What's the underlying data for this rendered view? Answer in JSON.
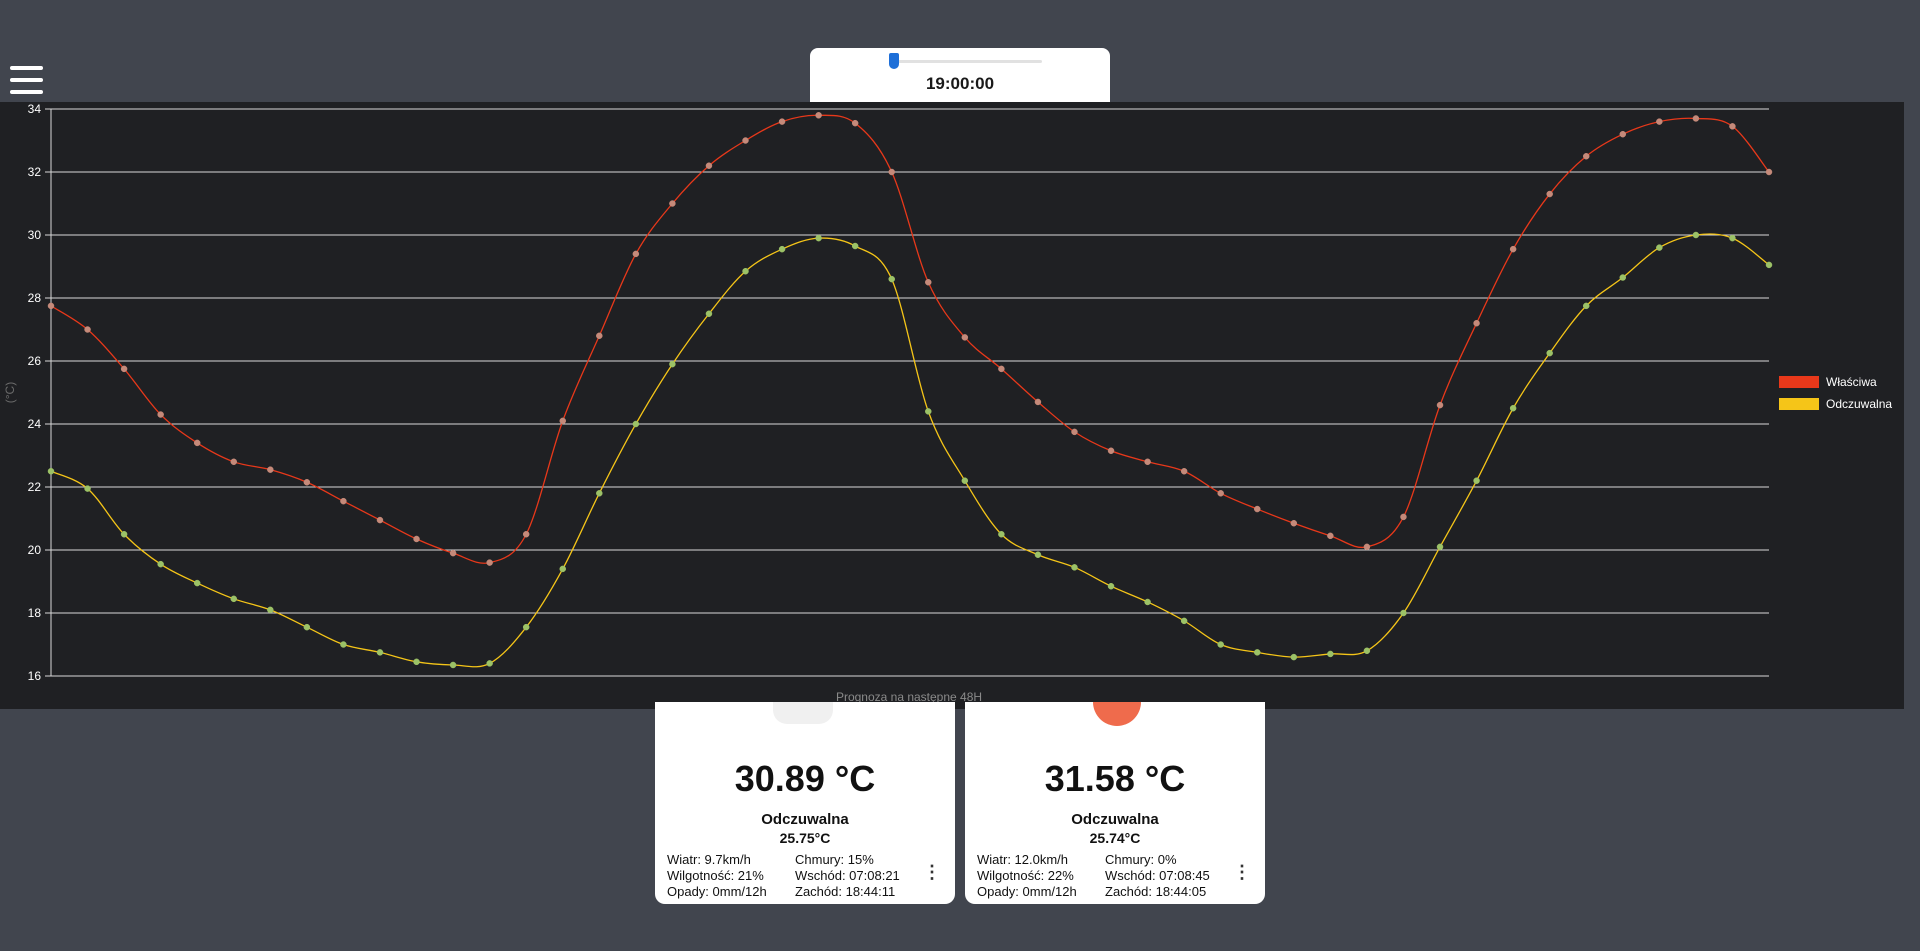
{
  "menu": {
    "icon": "hamburger-menu-icon"
  },
  "time_slider": {
    "time": "19:00:00",
    "position": 0.0
  },
  "chart_data": {
    "type": "line",
    "title": "",
    "xlabel": "Prognoza na następne 48H",
    "ylabel": "(°C)",
    "ylim": [
      16,
      34
    ],
    "yticks": [
      16,
      18,
      20,
      22,
      24,
      26,
      28,
      30,
      32,
      34
    ],
    "grid": true,
    "legend_position": "right",
    "x": [
      0,
      1,
      2,
      3,
      4,
      5,
      6,
      7,
      8,
      9,
      10,
      11,
      12,
      13,
      14,
      15,
      16,
      17,
      18,
      19,
      20,
      21,
      22,
      23,
      24,
      25,
      26,
      27,
      28,
      29,
      30,
      31,
      32,
      33,
      34,
      35,
      36,
      37,
      38,
      39,
      40,
      41,
      42,
      43,
      44,
      45,
      46,
      47
    ],
    "series": [
      {
        "name": "Właściwa",
        "color": "#e8381a",
        "values": [
          27.75,
          27.0,
          25.75,
          24.3,
          23.4,
          22.8,
          22.55,
          22.15,
          21.55,
          20.95,
          20.35,
          19.9,
          19.6,
          20.5,
          24.1,
          26.8,
          29.4,
          31.0,
          32.2,
          33.0,
          33.6,
          33.8,
          33.55,
          32.0,
          28.5,
          26.75,
          25.75,
          24.7,
          23.75,
          23.15,
          22.8,
          22.5,
          21.8,
          21.3,
          20.85,
          20.45,
          20.1,
          21.05,
          24.6,
          27.2,
          29.55,
          31.3,
          32.5,
          33.2,
          33.6,
          33.7,
          33.45,
          32.0
        ]
      },
      {
        "name": "Odczuwalna",
        "color": "#f5c518",
        "values": [
          22.5,
          21.95,
          20.5,
          19.55,
          18.95,
          18.45,
          18.1,
          17.55,
          17.0,
          16.75,
          16.45,
          16.35,
          16.4,
          17.55,
          19.4,
          21.8,
          24.0,
          25.9,
          27.5,
          28.85,
          29.55,
          29.9,
          29.65,
          28.6,
          24.4,
          22.2,
          20.5,
          19.85,
          19.45,
          18.85,
          18.35,
          17.75,
          17.0,
          16.75,
          16.6,
          16.7,
          16.8,
          18.0,
          20.1,
          22.2,
          24.5,
          26.25,
          27.75,
          28.65,
          29.6,
          30.0,
          29.9,
          29.05
        ]
      }
    ]
  },
  "cards": [
    {
      "icon": "cloud-icon",
      "temperature": "30.89 °C",
      "feels_label": "Odczuwalna",
      "feels_value": "25.75°C",
      "details": [
        "Wiatr: 9.7km/h",
        "Chmury: 15%",
        "Wilgotność: 21%",
        "Wschód: 07:08:21",
        "Opady: 0mm/12h",
        "Zachód: 18:44:11"
      ]
    },
    {
      "icon": "sun-icon",
      "temperature": "31.58 °C",
      "feels_label": "Odczuwalna",
      "feels_value": "25.74°C",
      "details": [
        "Wiatr: 12.0km/h",
        "Chmury: 0%",
        "Wilgotność: 22%",
        "Wschód: 07:08:45",
        "Opady: 0mm/12h",
        "Zachód: 18:44:05"
      ]
    }
  ]
}
